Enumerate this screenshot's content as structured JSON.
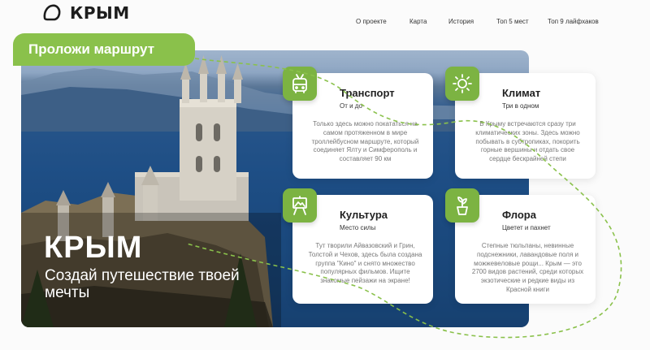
{
  "header": {
    "logo_text": "КРЫМ",
    "nav": [
      "О проекте",
      "Карта",
      "История",
      "Топ 5 мест",
      "Топ 9 лайфхаков"
    ]
  },
  "route_button": "Проложи маршрут",
  "hero": {
    "title": "КРЫМ",
    "subtitle": "Создай путешествие твоей мечты"
  },
  "cards": [
    {
      "icon": "trolleybus-icon",
      "title": "Транспорт",
      "subtitle": "От и до",
      "body": "Только здесь можно покататься на самом протяженном в мире троллейбусном маршруте, который соединяет Ялту и Симферополь и составляет 90 км"
    },
    {
      "icon": "sun-icon",
      "title": "Климат",
      "subtitle": "Три в одном",
      "body": "В Крыму встречаются сразу три климатических зоны. Здесь можно побывать в субтропиках, покорить горные вершины и отдать свое сердце бескрайней степи"
    },
    {
      "icon": "easel-icon",
      "title": "Культура",
      "subtitle": "Место силы",
      "body": "Тут творили Айвазовский и Грин, Толстой и Чехов, здесь была создана группа \"Кино\" и снято множество популярных фильмов. Ищите знакомые пейзажи на экране!"
    },
    {
      "icon": "plant-icon",
      "title": "Флора",
      "subtitle": "Цветет и пахнет",
      "body": "Степные тюльпаны, невинные подснежники, лавандовые поля и можжевеловые рощи... Крым — это 2700 видов растений, среди которых экзотические и редкие виды из Красной книги"
    }
  ],
  "colors": {
    "accent": "#8ac14b",
    "icon_bg": "#7cb342"
  }
}
